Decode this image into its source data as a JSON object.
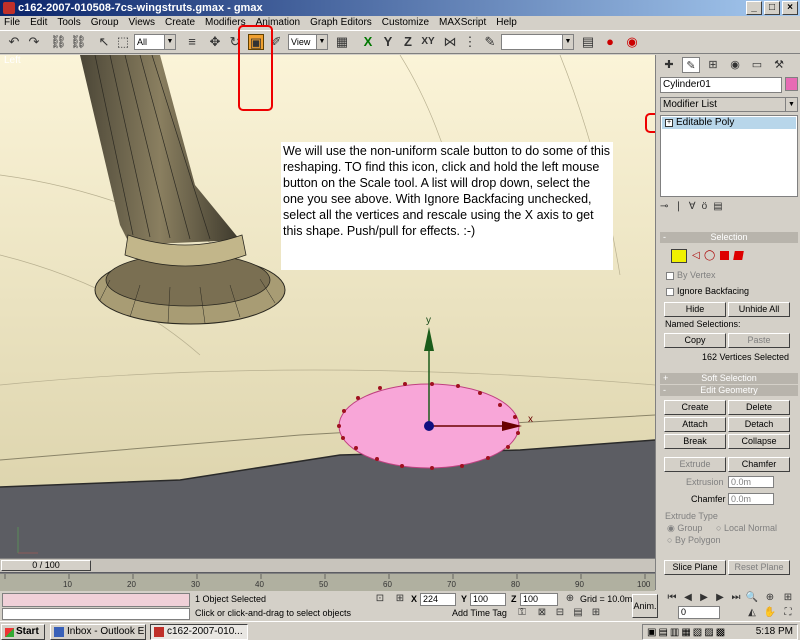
{
  "window": {
    "title": "c162-2007-010508-7cs-wingstruts.gmax - gmax",
    "controls": [
      "_",
      "□",
      "×"
    ]
  },
  "menu": [
    "File",
    "Edit",
    "Tools",
    "Group",
    "Views",
    "Create",
    "Modifiers",
    "Animation",
    "Graph Editors",
    "Customize",
    "MAXScript",
    "Help"
  ],
  "toolbar": {
    "selection_filter": "All",
    "coord_system": "View",
    "axis_constraints": [
      "X",
      "Y",
      "Z",
      "XY"
    ]
  },
  "viewport": {
    "label": "Left",
    "callout": "We will use the non-uniform scale button to do some of this reshaping.  TO find this icon, click and hold the left mouse button on the Scale tool.  A list will drop down, select the one you see above.  With Ignore Backfacing unchecked, select all the vertices and rescale using the X axis to get this shape. Push/pull for effects. :-)",
    "gizmo_y": "y",
    "gizmo_x": "x"
  },
  "panel": {
    "object_name": "Cylinder01",
    "object_color": "#e76bb4",
    "modifier_list": "Modifier List",
    "stack_item": "Editable Poly",
    "selection_title": "Selection",
    "by_vertex": "By Vertex",
    "ignore_backfacing": "Ignore Backfacing",
    "hide": "Hide",
    "unhide_all": "Unhide All",
    "named_selections": "Named Selections:",
    "copy": "Copy",
    "paste": "Paste",
    "selected_count": "162 Vertices Selected",
    "soft_selection": "Soft Selection",
    "edit_geometry": "Edit Geometry",
    "create": "Create",
    "delete": "Delete",
    "attach": "Attach",
    "detach": "Detach",
    "break": "Break",
    "collapse": "Collapse",
    "extrude": "Extrude",
    "chamfer": "Chamfer",
    "extrusion_label": "Extrusion",
    "extrusion_value": "0.0m",
    "chamfer_label": "Chamfer",
    "chamfer_value": "0.0m",
    "extrude_type": "Extrude Type",
    "group": "Group",
    "local_normal": "Local Normal",
    "by_polygon": "By Polygon",
    "slice_plane": "Slice Plane",
    "reset_plane": "Reset Plane"
  },
  "timeline": {
    "slider_label": "0 / 100",
    "ticks": [
      "10",
      "20",
      "30",
      "40",
      "50",
      "60",
      "70",
      "80",
      "90",
      "100"
    ]
  },
  "status": {
    "objects_selected": "1 Object Selected",
    "prompt": "Click or click-and-drag to select objects",
    "x_label": "X",
    "x_value": "224",
    "y_label": "Y",
    "y_value": "100",
    "z_label": "Z",
    "z_value": "100",
    "grid": "Grid = 10.0m",
    "add_time_tag": "Add Time Tag",
    "anim": "Anim.",
    "frame": "0"
  },
  "taskbar": {
    "start": "Start",
    "tasks": [
      "Inbox - Outlook E...",
      "c162-2007-010..."
    ],
    "clock": "5:18 PM"
  }
}
